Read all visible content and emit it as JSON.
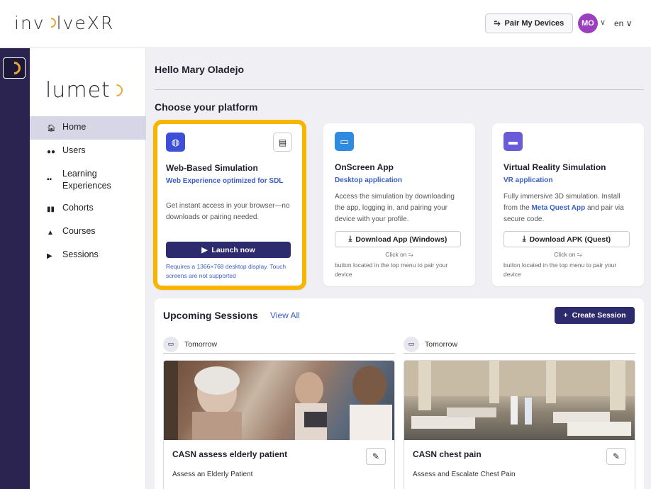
{
  "header": {
    "brand": {
      "pre": "inv",
      "post": "lveXR"
    },
    "pair_button": "Pair My Devices",
    "user_initials": "MO",
    "language": "en",
    "avatar_color": "#9b3fbf"
  },
  "sidebar": {
    "logo": {
      "pre": "lumet"
    },
    "items": [
      {
        "label": "Home",
        "icon": "home-icon",
        "active": true
      },
      {
        "label": "Users",
        "icon": "users-icon"
      },
      {
        "label": "Learning Experiences",
        "icon": "grid-icon"
      },
      {
        "label": "Cohorts",
        "icon": "book-icon"
      },
      {
        "label": "Courses",
        "icon": "graduation-cap-icon"
      },
      {
        "label": "Sessions",
        "icon": "play-icon"
      }
    ]
  },
  "main": {
    "greeting": "Hello Mary Oladejo",
    "platform_heading": "Choose your platform",
    "platforms": [
      {
        "title": "Web-Based Simulation",
        "subtitle": "Web Experience optimized for SDL",
        "description": "Get instant access in your browser—no downloads or pairing needed.",
        "button": "Launch now",
        "note": "Requires a 1366×768 desktop display. Touch screens are not supported",
        "icon": "globe-icon",
        "icon_color": "#3d4fd6"
      },
      {
        "title": "OnScreen App",
        "subtitle": "Desktop application",
        "description": "Access the simulation by downloading the app, logging in, and pairing your device with your profile.",
        "button": "Download App (Windows)",
        "click_on": "Click on",
        "pair_note": "button located in the top menu to pair your device",
        "icon": "monitor-icon",
        "icon_color": "#2f8be0"
      },
      {
        "title": "Virtual Reality Simulation",
        "subtitle": "VR application",
        "description_pre": "Fully immersive 3D simulation. Install from the ",
        "description_link": "Meta Quest App",
        "description_post": " and pair via secure code.",
        "button": "Download APK (Quest)",
        "click_on": "Click on",
        "pair_note": "button located in the top menu to pair your device",
        "icon": "vr-headset-icon",
        "icon_color": "#6a5bd8"
      }
    ],
    "sessions": {
      "heading": "Upcoming Sessions",
      "view_all": "View All",
      "create_button": "Create Session",
      "items": [
        {
          "date": "Tomorrow",
          "name": "CASN assess elderly patient",
          "description": "Assess an Elderly Patient"
        },
        {
          "date": "Tomorrow",
          "name": "CASN chest pain",
          "description": "Assess and Escalate Chest Pain"
        }
      ]
    }
  }
}
